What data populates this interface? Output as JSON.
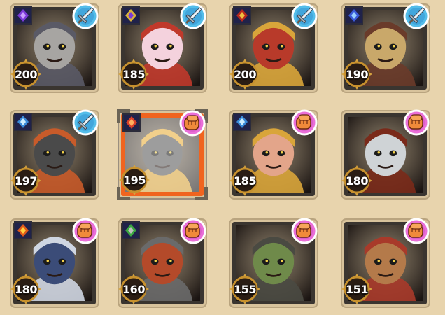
{
  "heroes": [
    {
      "power": "200",
      "type": "sword",
      "item": "purple-gem",
      "selected": false,
      "portrait": "knight-bear",
      "skin": "#a7a5a2",
      "accent": "#5a5a66",
      "bg": "#7a6d5c"
    },
    {
      "power": "185",
      "type": "sword",
      "item": "golden-sword",
      "selected": false,
      "portrait": "red-haired-girl",
      "skin": "#f4d2dd",
      "accent": "#c0392b",
      "bg": "#7a3b35"
    },
    {
      "power": "200",
      "type": "sword",
      "item": "red-tome",
      "selected": false,
      "portrait": "horned-demon",
      "skin": "#b83a2a",
      "accent": "#d9a53a",
      "bg": "#8a5a2a"
    },
    {
      "power": "190",
      "type": "sword",
      "item": "blue-crystal",
      "selected": false,
      "portrait": "skull-mech",
      "skin": "#c9a86a",
      "accent": "#6a3b2a",
      "bg": "#5a4034"
    },
    {
      "power": "197",
      "type": "sword",
      "item": "ice-shard",
      "selected": false,
      "portrait": "armored-giant",
      "skin": "#4a4a4a",
      "accent": "#c85b2a",
      "bg": "#6a3a2a"
    },
    {
      "power": "195",
      "type": "fist",
      "item": "red-wing",
      "selected": true,
      "portrait": "stone-golem",
      "skin": "#5a5a5a",
      "accent": "#f2b53a",
      "bg": "#6a6a6a"
    },
    {
      "power": "185",
      "type": "fist",
      "item": "ice-shard",
      "selected": false,
      "portrait": "gold-helmet-warrior",
      "skin": "#e3a58a",
      "accent": "#d9a53a",
      "bg": "#7a4a2a"
    },
    {
      "power": "180",
      "type": "fist",
      "item": "none",
      "selected": false,
      "portrait": "iron-mask",
      "skin": "#cfd3d6",
      "accent": "#7a2a1a",
      "bg": "#a33a1a"
    },
    {
      "power": "180",
      "type": "fist",
      "item": "fire-orb",
      "selected": false,
      "portrait": "horned-ogre",
      "skin": "#3b4c78",
      "accent": "#cfd6e2",
      "bg": "#3a3b58"
    },
    {
      "power": "160",
      "type": "fist",
      "item": "green-axe",
      "selected": false,
      "portrait": "red-berserker",
      "skin": "#b44a2a",
      "accent": "#6a6a6a",
      "bg": "#8a3a22"
    },
    {
      "power": "155",
      "type": "fist",
      "item": "none",
      "selected": false,
      "portrait": "moss-golem",
      "skin": "#6f8a4a",
      "accent": "#4a4a42",
      "bg": "#4a4a3a"
    },
    {
      "power": "151",
      "type": "fist",
      "item": "none",
      "selected": false,
      "portrait": "ogre-goggles",
      "skin": "#b47a4a",
      "accent": "#a83a2a",
      "bg": "#7a3a22"
    }
  ]
}
